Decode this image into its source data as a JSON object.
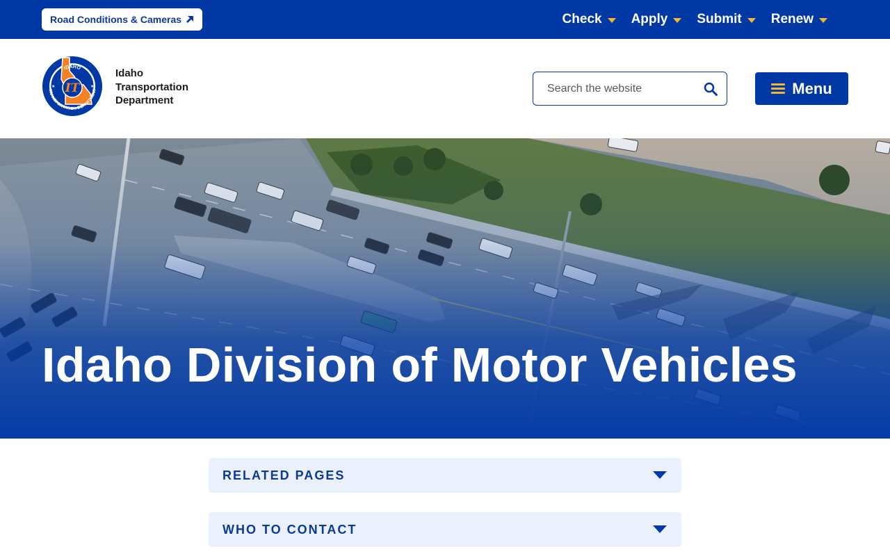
{
  "utility_bar": {
    "road_conditions_label": "Road Conditions & Cameras",
    "nav": [
      {
        "label": "Check"
      },
      {
        "label": "Apply"
      },
      {
        "label": "Submit"
      },
      {
        "label": "Renew"
      }
    ]
  },
  "header": {
    "org_name_lines": [
      "Idaho",
      "Transportation",
      "Department"
    ],
    "logo": {
      "ring_text_top": "IDAHO",
      "ring_text_bottom": "TRANSPORTATION DEPARTMENT",
      "monogram": "IT"
    },
    "search": {
      "placeholder": "Search the website"
    },
    "menu_label": "Menu"
  },
  "hero": {
    "title": "Idaho Division of Motor Vehicles"
  },
  "accordions": [
    {
      "label": "RELATED PAGES"
    },
    {
      "label": "WHO TO CONTACT"
    }
  ],
  "colors": {
    "brand_blue": "#0039a6",
    "accent_gold": "#f2b632",
    "logo_orange": "#f58220",
    "accordion_bg": "#eaf1fc"
  }
}
